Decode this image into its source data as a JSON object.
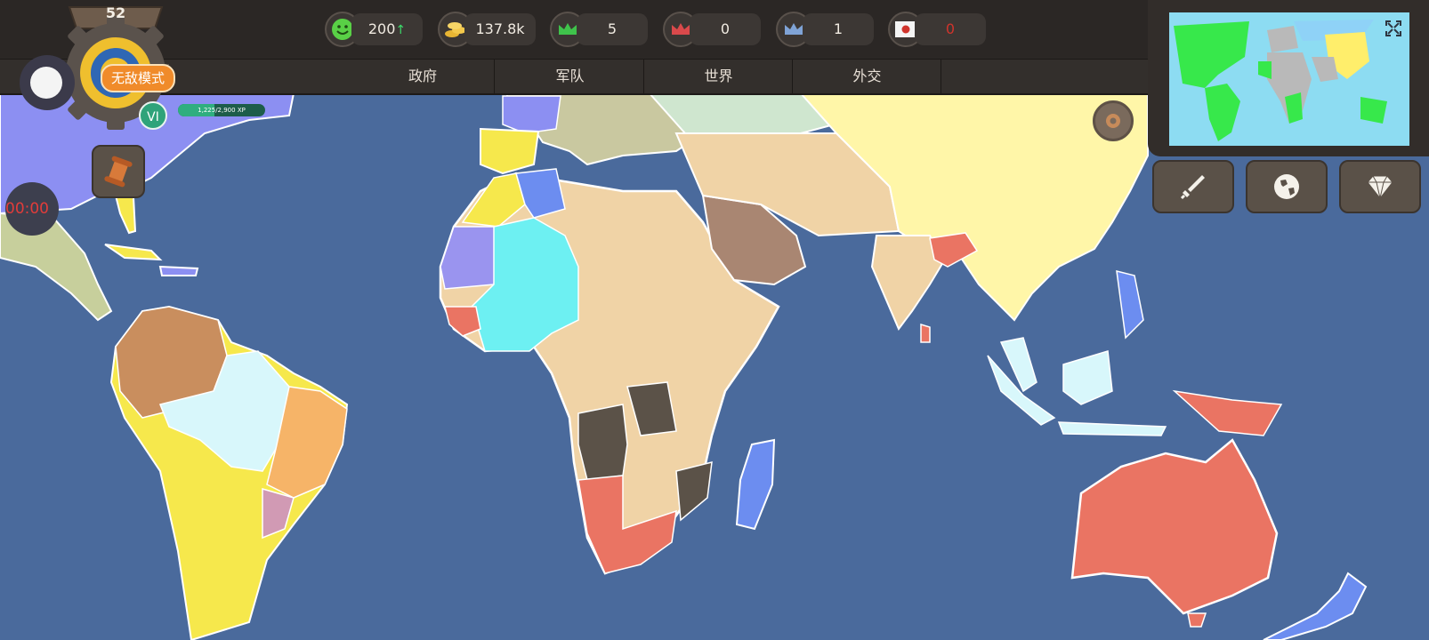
{
  "player": {
    "level": "52",
    "mode_label": "无敌模式",
    "rank": "VI",
    "xp_text": "1,225/2,900 XP",
    "timer": "00:00"
  },
  "stats": [
    {
      "icon": "smiley-icon",
      "value": "200",
      "trend": "↑",
      "value_color": "#f1ebe2"
    },
    {
      "icon": "coins-icon",
      "value": "137.8k",
      "trend": "↑",
      "value_color": "#f1ebe2"
    },
    {
      "icon": "green-crown-icon",
      "value": "5",
      "trend": "",
      "value_color": "#f1ebe2"
    },
    {
      "icon": "red-crown-icon",
      "value": "0",
      "trend": "",
      "value_color": "#f1ebe2"
    },
    {
      "icon": "blue-crown-icon",
      "value": "1",
      "trend": "",
      "value_color": "#f1ebe2"
    },
    {
      "icon": "japan-flag-icon",
      "value": "0",
      "trend": "",
      "value_color": "#d0342c"
    }
  ],
  "nav": {
    "tabs": [
      "政府",
      "军队",
      "世界",
      "外交"
    ]
  },
  "colors": {
    "ocean": "#4a6a9c",
    "north_america": "#8c8ff2",
    "south_america_yellow": "#f6e84c",
    "africa_tan": "#f0d3a6",
    "asia_yellow": "#fff6a8",
    "australia_red": "#ea7463",
    "minimap_green": "#37e84b"
  }
}
